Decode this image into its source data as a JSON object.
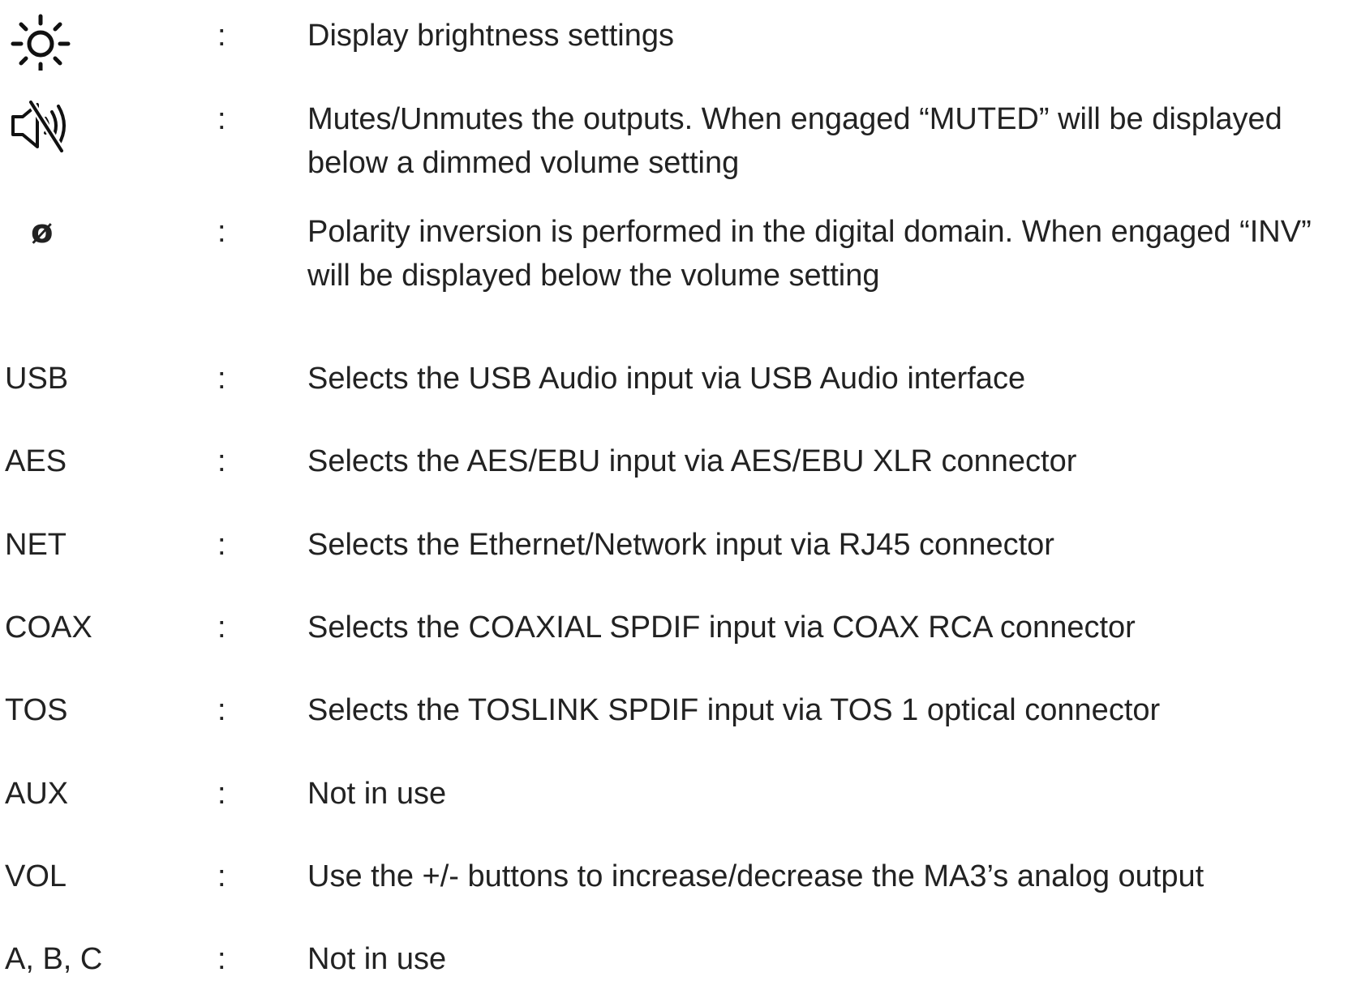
{
  "rows": [
    {
      "key": "",
      "icon": "sun-brightness-icon",
      "desc": "Display brightness settings"
    },
    {
      "key": "",
      "icon": "speaker-mute-icon",
      "desc": "Mutes/Unmutes the outputs. When engaged “MUTED” will be displayed below a dimmed volume setting"
    },
    {
      "key": "ø",
      "icon": "polarity-phi-icon",
      "desc": "Polarity inversion is performed in the digital domain. When engaged “INV” will be displayed below the volume setting"
    },
    {
      "key": "USB",
      "desc": "Selects the USB Audio input via USB Audio interface"
    },
    {
      "key": "AES",
      "desc": "Selects the AES/EBU input via AES/EBU XLR connector"
    },
    {
      "key": "NET",
      "desc": "Selects the Ethernet/Network input via RJ45 connector"
    },
    {
      "key": "COAX",
      "desc": "Selects the COAXIAL SPDIF input via COAX RCA connector"
    },
    {
      "key": "TOS",
      "desc": "Selects the TOSLINK SPDIF input via TOS 1 optical connector"
    },
    {
      "key": "AUX",
      "desc": "Not in use"
    },
    {
      "key": "VOL",
      "desc": "Use the +/- buttons to increase/decrease the MA3’s analog output"
    },
    {
      "key": "A, B, C",
      "desc": "Not in use"
    }
  ],
  "separator": ":"
}
